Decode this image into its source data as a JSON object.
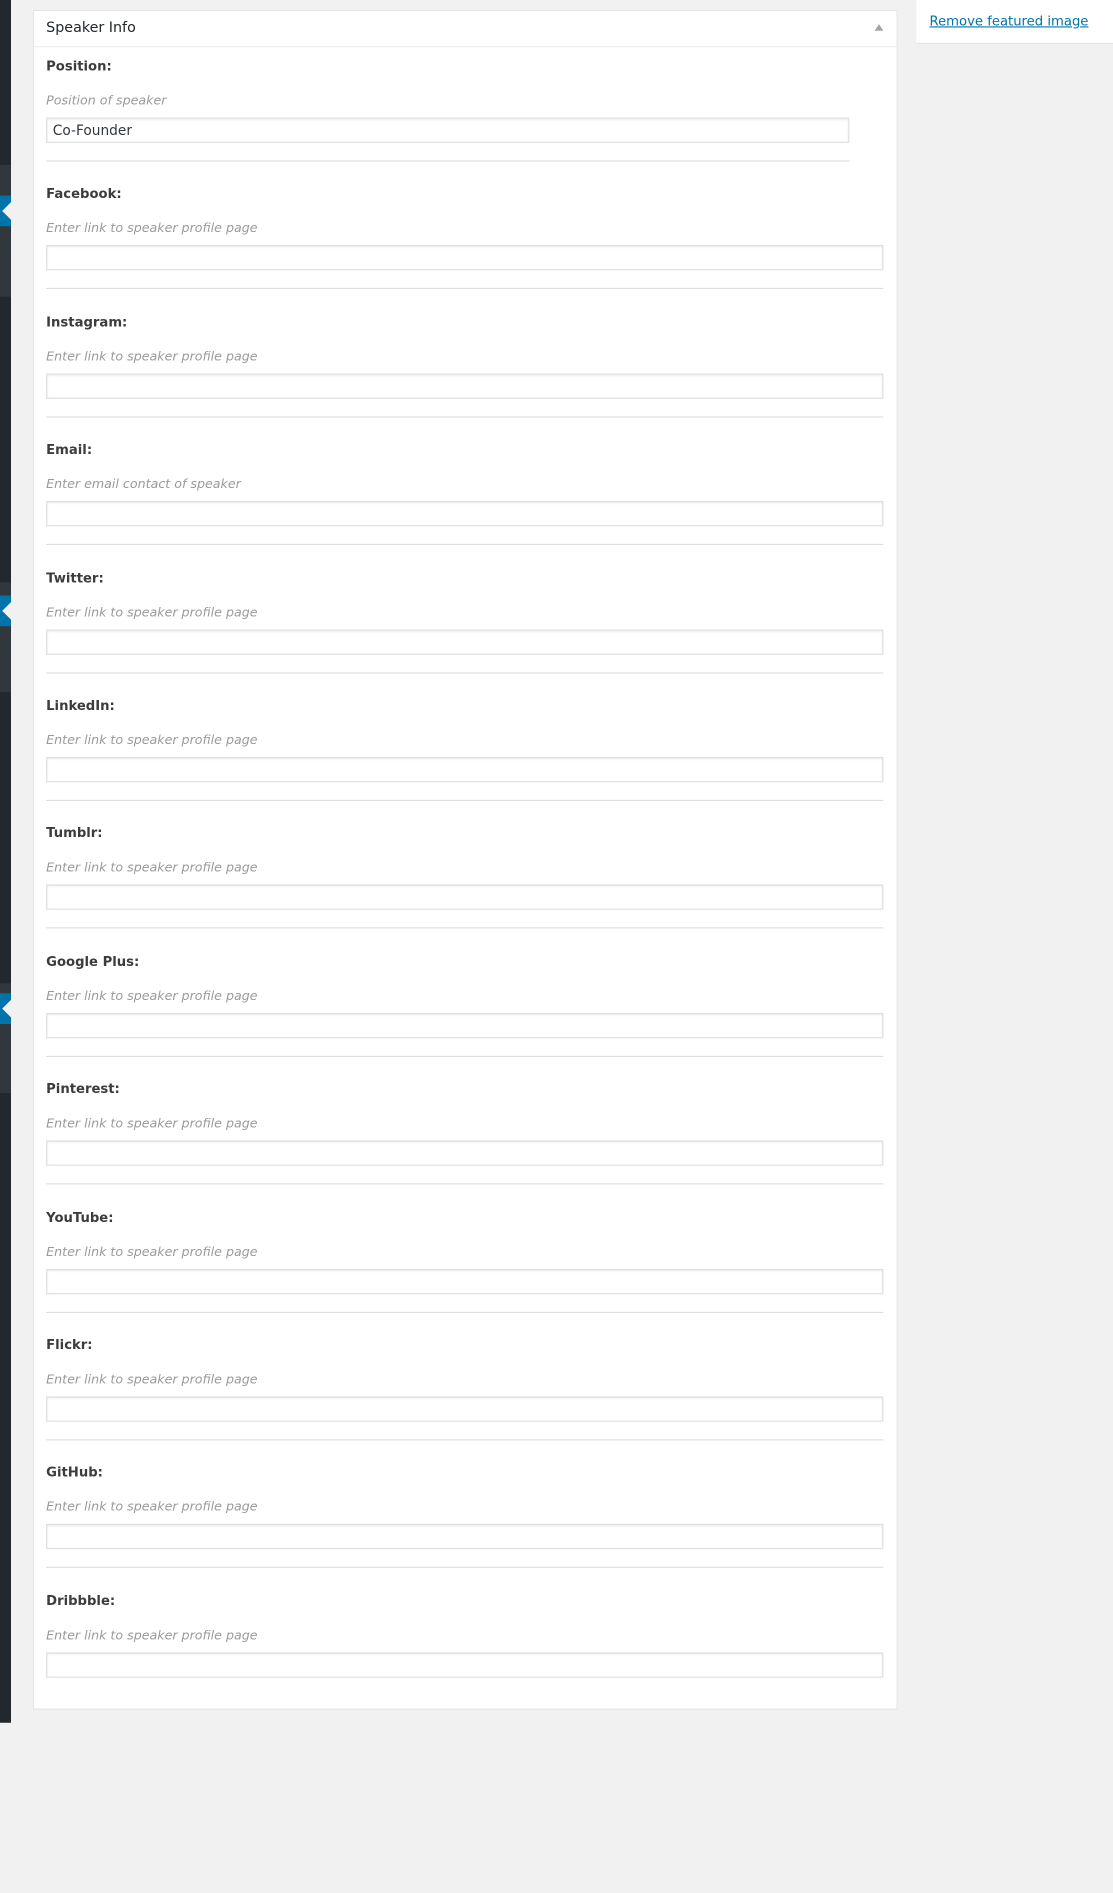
{
  "metabox": {
    "title": "Speaker Info"
  },
  "sidebar": {
    "remove_featured_image": "Remove featured image"
  },
  "fields": [
    {
      "label": "Position:",
      "description": "Position of speaker",
      "value": "Co-Founder"
    },
    {
      "label": "Facebook:",
      "description": "Enter link to speaker profile page",
      "value": ""
    },
    {
      "label": "Instagram:",
      "description": "Enter link to speaker profile page",
      "value": ""
    },
    {
      "label": "Email:",
      "description": "Enter email contact of speaker",
      "value": ""
    },
    {
      "label": "Twitter:",
      "description": "Enter link to speaker profile page",
      "value": ""
    },
    {
      "label": "LinkedIn:",
      "description": "Enter link to speaker profile page",
      "value": ""
    },
    {
      "label": "Tumblr:",
      "description": "Enter link to speaker profile page",
      "value": ""
    },
    {
      "label": "Google Plus:",
      "description": "Enter link to speaker profile page",
      "value": ""
    },
    {
      "label": "Pinterest:",
      "description": "Enter link to speaker profile page",
      "value": ""
    },
    {
      "label": "YouTube:",
      "description": "Enter link to speaker profile page",
      "value": ""
    },
    {
      "label": "Flickr:",
      "description": "Enter link to speaker profile page",
      "value": ""
    },
    {
      "label": "GitHub:",
      "description": "Enter link to speaker profile page",
      "value": ""
    },
    {
      "label": "Dribbble:",
      "description": "Enter link to speaker profile page",
      "value": ""
    }
  ],
  "colors": {
    "admin_menu": "#23282d",
    "accent": "#0073aa",
    "background": "#f1f1f1"
  }
}
